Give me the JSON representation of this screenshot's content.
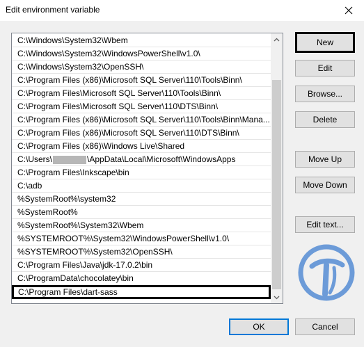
{
  "window": {
    "title": "Edit environment variable"
  },
  "list": {
    "items": [
      "C:\\Windows\\System32\\Wbem",
      "C:\\Windows\\System32\\WindowsPowerShell\\v1.0\\",
      "C:\\Windows\\System32\\OpenSSH\\",
      "C:\\Program Files (x86)\\Microsoft SQL Server\\110\\Tools\\Binn\\",
      "C:\\Program Files\\Microsoft SQL Server\\110\\Tools\\Binn\\",
      "C:\\Program Files\\Microsoft SQL Server\\110\\DTS\\Binn\\",
      "C:\\Program Files (x86)\\Microsoft SQL Server\\110\\Tools\\Binn\\Mana...",
      "C:\\Program Files (x86)\\Microsoft SQL Server\\110\\DTS\\Binn\\",
      "C:\\Program Files (x86)\\Windows Live\\Shared",
      "",
      "C:\\Program Files\\Inkscape\\bin",
      "C:\\adb",
      "%SystemRoot%\\system32",
      "%SystemRoot%",
      "%SystemRoot%\\System32\\Wbem",
      "%SYSTEMROOT%\\System32\\WindowsPowerShell\\v1.0\\",
      "%SYSTEMROOT%\\System32\\OpenSSH\\",
      "C:\\Program Files\\Java\\jdk-17.0.2\\bin",
      "C:\\ProgramData\\chocolatey\\bin",
      "C:\\Program Files\\dart-sass"
    ],
    "redacted_prefix": "C:\\Users\\",
    "redacted_suffix": "\\AppData\\Local\\Microsoft\\WindowsApps"
  },
  "buttons": {
    "new": "New",
    "edit": "Edit",
    "browse": "Browse...",
    "delete": "Delete",
    "move_up": "Move Up",
    "move_down": "Move Down",
    "edit_text": "Edit text...",
    "ok": "OK",
    "cancel": "Cancel"
  },
  "colors": {
    "accent": "#0078d7",
    "watermark": "#6c9bd8"
  }
}
